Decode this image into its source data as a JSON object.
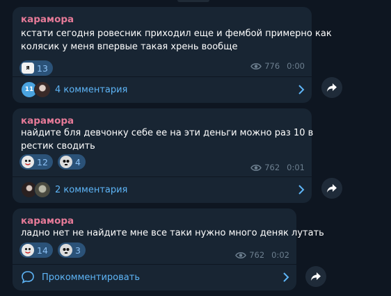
{
  "posts": [
    {
      "author": "карамора",
      "text_lines": [
        "кстати сегодня ровесник приходил еще и фембой примерно как",
        "колясик у меня впервые такая хрень вообще"
      ],
      "reactions": [
        {
          "emoji": "ya-sticker-icon",
          "count": "13"
        }
      ],
      "views": "776",
      "time": "0:00",
      "comment_avatar_badge": "11",
      "comments_label": "4 комментария"
    },
    {
      "author": "карамора",
      "text_lines": [
        "найдите бля девчонку себе ее на эти деньги можно раз 10 в",
        "рестик сводить"
      ],
      "reactions": [
        {
          "emoji": "clown-mask-icon",
          "count": "12"
        },
        {
          "emoji": "skull-icon",
          "count": "4"
        }
      ],
      "views": "762",
      "time": "0:01",
      "comments_label": "2 комментария"
    },
    {
      "author": "карамора",
      "text_lines": [
        "ладно нет не найдите мне все таки нужно много деняк лутать"
      ],
      "reactions": [
        {
          "emoji": "clown-mask-icon",
          "count": "14"
        },
        {
          "emoji": "skull-icon",
          "count": "3"
        }
      ],
      "views": "762",
      "time": "0:02",
      "comments_label": "Прокомментировать"
    }
  ],
  "colors": {
    "background": "#0e1621",
    "bubble": "#182533",
    "author": "#e67a98",
    "link": "#5eb5f7",
    "reaction_bg": "#2b5278",
    "meta": "#6d7f8f"
  }
}
